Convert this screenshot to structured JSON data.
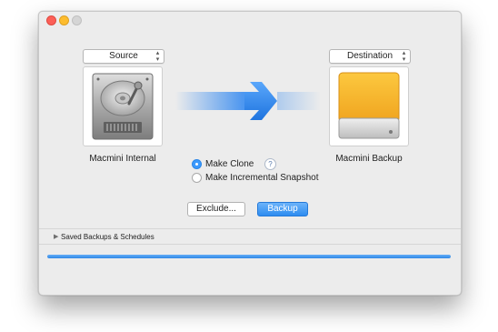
{
  "source": {
    "popup_label": "Source",
    "volume_name": "Macmini Internal"
  },
  "destination": {
    "popup_label": "Destination",
    "volume_name": "Macmini Backup"
  },
  "options": {
    "make_clone": {
      "label": "Make Clone",
      "selected": true
    },
    "incremental": {
      "label": "Make Incremental Snapshot",
      "selected": false
    },
    "help_glyph": "?"
  },
  "buttons": {
    "exclude": "Exclude...",
    "backup": "Backup"
  },
  "saved_section": {
    "label": "Saved Backups & Schedules",
    "expanded": false
  },
  "progress": {
    "fraction": 1.0
  },
  "colors": {
    "accent": "#3b99fc",
    "arrow": "#3d8ef0",
    "dest_drive": "#f6b730"
  },
  "icons": {
    "source": "hard-drive-icon",
    "destination": "external-drive-icon",
    "arrow": "arrow-right-icon",
    "disclosure": "disclosure-triangle-icon",
    "help": "help-icon"
  }
}
